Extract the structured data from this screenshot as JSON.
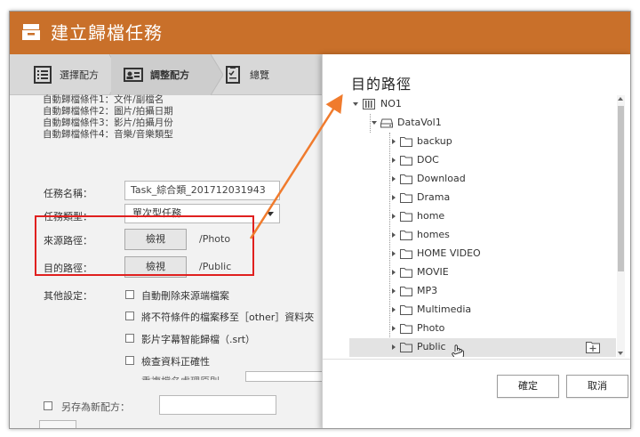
{
  "window": {
    "title": "建立歸檔任務"
  },
  "steps": [
    {
      "label": "選擇配方",
      "icon": "list-icon"
    },
    {
      "label": "調整配方",
      "icon": "id-card-icon"
    },
    {
      "label": "總覽",
      "icon": "checklist-icon"
    }
  ],
  "conditions": [
    "自動歸檔條件1：文件/副檔名",
    "自動歸檔條件2：圖片/拍攝日期",
    "自動歸檔條件3：影片/拍攝月份",
    "自動歸檔條件4：音樂/音樂類型"
  ],
  "form": {
    "task_name_label": "任務名稱：",
    "task_name_value": "Task_綜合類_201712031943",
    "task_type_label": "任務類型：",
    "task_type_value": "單次型任務",
    "source_label": "來源路徑：",
    "source_button": "檢視",
    "source_path": "/Photo",
    "dest_label": "目的路徑：",
    "dest_button": "檢視",
    "dest_path": "/Public",
    "other_label": "其他設定：",
    "options": [
      "自動刪除來源端檔案",
      "將不符條件的檔案移至［other］資料夾",
      "影片字幕智能歸檔（.srt）",
      "檢查資料正確性"
    ],
    "partial_label": "重複檔名處理原則",
    "save_recipe_label": "另存為新配方："
  },
  "dialog": {
    "title": "目的路徑",
    "root": "NO1",
    "volume": "DataVol1",
    "folders": [
      "backup",
      "DOC",
      "Download",
      "Drama",
      "home",
      "homes",
      "HOME VIDEO",
      "MOVIE",
      "MP3",
      "Multimedia",
      "Photo",
      "Public"
    ],
    "selected_folder": "Public",
    "ok_label": "確定",
    "cancel_label": "取消"
  },
  "colors": {
    "title_bar": "#c9702a",
    "highlight_box": "#e0201f",
    "annotation_arrow": "#f07b2d"
  }
}
